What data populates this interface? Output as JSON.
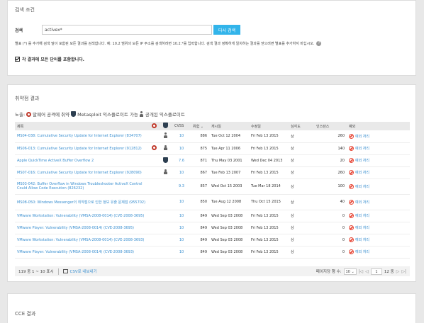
{
  "search": {
    "section_title": "검색 조건",
    "label": "검색",
    "input_value": "activex*",
    "button_label": "다시 검색",
    "hint": "별표 (*) 를 추가해 검색 말이 포함된 모든 결과를 검색합니다. 예: 10.2 범위의 모든 IP 주소를 검색하려면 10.2.*를 입력합니다. 검색 결과 정확하게 일치하는 결과를 얻으려면 별표를 추가하지 마십시오.",
    "checkbox_label": "각 결과에 모든 단어를 포함합니다."
  },
  "vuln": {
    "section_title": "취약점 결과",
    "legend": {
      "prefix": "노출:",
      "text1": "말웨어 공격에 취약",
      "text2": "Metasploit 익스플로이트 가능",
      "text3": "공개된 익스플로이트"
    },
    "columns": [
      "제목",
      "",
      "",
      "CVSS",
      "위험",
      "게시일",
      "수정일",
      "심각도",
      "인스턴스",
      "예외"
    ],
    "rows": [
      {
        "title": "MS04-038: Cumulative Security Update for Internet Explorer (834707)",
        "malware": false,
        "meta": false,
        "pub": true,
        "cvss": "10",
        "risk": "886",
        "published": "Tue Oct 12 2004",
        "modified": "Fri Feb 13 2015",
        "instances": "260",
        "exception": "예외 처리"
      },
      {
        "title": "MS06-013: Cumulative Security Update for Internet Explorer (912812)",
        "malware": true,
        "meta": false,
        "pub": true,
        "cvss": "10",
        "risk": "875",
        "published": "Tue Apr 11 2006",
        "modified": "Fri Feb 13 2015",
        "instances": "140",
        "exception": "예외 처리"
      },
      {
        "title": "Apple QuickTime ActiveX Buffer Overflow 2",
        "malware": false,
        "meta": true,
        "pub": false,
        "cvss": "7.6",
        "risk": "871",
        "published": "Thu May 03 2001",
        "modified": "Wed Dec 04 2013",
        "instances": "20",
        "exception": "예외 처리"
      },
      {
        "title": "MS07-016: Cumulative Security Update for Internet Explorer (928090)",
        "malware": false,
        "meta": false,
        "pub": true,
        "cvss": "10",
        "risk": "867",
        "published": "Tue Feb 13 2007",
        "modified": "Fri Feb 13 2015",
        "instances": "260",
        "exception": "예외 처리"
      },
      {
        "title": "MS03-042: Buffer Overflow in Windows Troubleshooter ActiveX Control Could Allow Code Execution (826232)",
        "malware": false,
        "meta": false,
        "pub": false,
        "cvss": "9.3",
        "risk": "857",
        "published": "Wed Oct 15 2003",
        "modified": "Tue Mar 18 2014",
        "instances": "100",
        "exception": "예외 처리"
      },
      {
        "title": "MS08-050: Windows Messenger의 취약점으로 인한 정보 유출 문제점 (955702)",
        "malware": false,
        "meta": false,
        "pub": false,
        "cvss": "10",
        "risk": "850",
        "published": "Tue Aug 12 2008",
        "modified": "Thu Oct 15 2015",
        "instances": "40",
        "exception": "예외 처리"
      },
      {
        "title": "VMware Workstation: Vulnerability (VMSA-2008-0014) (CVE-2008-3695)",
        "malware": false,
        "meta": false,
        "pub": false,
        "cvss": "10",
        "risk": "849",
        "published": "Wed Sep 03 2008",
        "modified": "Fri Feb 13 2015",
        "instances": "0",
        "exception": "예외 처리"
      },
      {
        "title": "VMware Player: Vulnerability (VMSA-2008-0014) (CVE-2008-3695)",
        "malware": false,
        "meta": false,
        "pub": false,
        "cvss": "10",
        "risk": "849",
        "published": "Wed Sep 03 2008",
        "modified": "Fri Feb 13 2015",
        "instances": "0",
        "exception": "예외 처리"
      },
      {
        "title": "VMware Workstation: Vulnerability (VMSA-2008-0014) (CVE-2008-3693)",
        "malware": false,
        "meta": false,
        "pub": false,
        "cvss": "10",
        "risk": "849",
        "published": "Wed Sep 03 2008",
        "modified": "Fri Feb 13 2015",
        "instances": "0",
        "exception": "예외 처리"
      },
      {
        "title": "VMware Player: Vulnerability (VMSA-2008-0014) (CVE-2008-3693)",
        "malware": false,
        "meta": false,
        "pub": false,
        "cvss": "10",
        "risk": "849",
        "published": "Wed Sep 03 2008",
        "modified": "Fri Feb 13 2015",
        "instances": "0",
        "exception": "예외 처리"
      }
    ],
    "severity_glyph": "상",
    "footer": {
      "count": "119 중 1 ~ 10 표시",
      "csv": "CSV로 내보내기",
      "per_page": "페이지당 행 수:",
      "per_page_value": "10",
      "page": "1",
      "total_pages": "12 중"
    }
  },
  "cce": {
    "section_title": "CCE 결과"
  },
  "colors": {
    "accent": "#32b4ea",
    "link": "#3a8fd0",
    "danger": "#e74c3c"
  }
}
